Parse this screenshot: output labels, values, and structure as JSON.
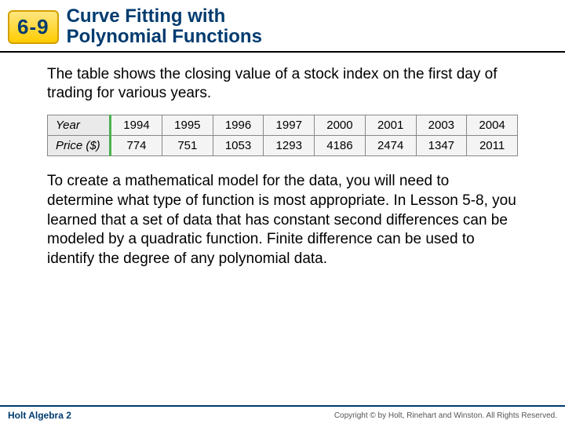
{
  "header": {
    "badge": "6-9",
    "title_line1": "Curve Fitting with",
    "title_line2": "Polynomial Functions"
  },
  "intro_text": "The table shows the closing value of a stock index on the first day of trading for various years.",
  "table": {
    "row_labels": [
      "Year",
      "Price ($)"
    ],
    "years": [
      "1994",
      "1995",
      "1996",
      "1997",
      "2000",
      "2001",
      "2003",
      "2004"
    ],
    "prices": [
      "774",
      "751",
      "1053",
      "1293",
      "4186",
      "2474",
      "1347",
      "2011"
    ]
  },
  "chart_data": {
    "type": "table",
    "title": "Stock index closing value on first trading day",
    "categories": [
      1994,
      1995,
      1996,
      1997,
      2000,
      2001,
      2003,
      2004
    ],
    "values": [
      774,
      751,
      1053,
      1293,
      4186,
      2474,
      1347,
      2011
    ],
    "xlabel": "Year",
    "ylabel": "Price ($)"
  },
  "body_text": "To create a mathematical model for the data, you will need to determine what type of function is most appropriate. In Lesson 5-8, you learned that a set of data that has constant second differences can be modeled by a quadratic function. Finite difference can be used to identify the degree of any polynomial data.",
  "footer": {
    "book": "Holt Algebra 2",
    "copyright": "Copyright © by Holt, Rinehart and Winston. All Rights Reserved."
  }
}
